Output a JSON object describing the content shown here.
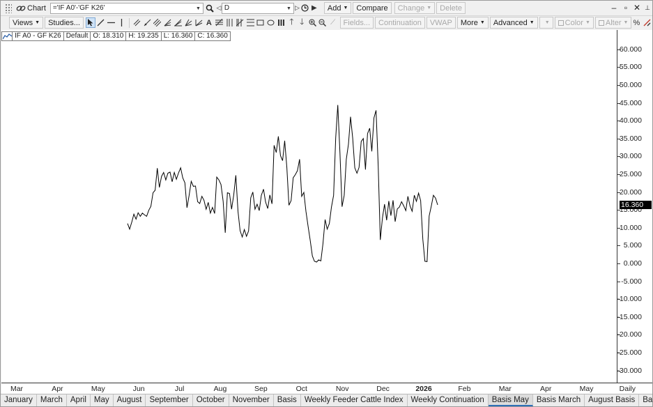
{
  "titlebar": {
    "window_label": "Chart",
    "symbol_value": "='IF A0'-'GF K26'",
    "period_value": "D",
    "buttons": {
      "add": "Add",
      "compare": "Compare",
      "change": "Change",
      "delete": "Delete"
    }
  },
  "toolbar": {
    "views": "Views",
    "studies": "Studies...",
    "fields": "Fields...",
    "continuation": "Continuation",
    "vwap": "VWAP",
    "more": "More",
    "advanced": "Advanced",
    "color": "Color",
    "alter": "Alter",
    "percent": "%"
  },
  "legend": {
    "symbol": "IF A0 - GF K26",
    "template": "Default",
    "open": "O: 18.310",
    "high": "H: 19.235",
    "low": "L: 16.360",
    "close": "C: 16.360"
  },
  "chart_data": {
    "type": "line",
    "series": [
      {
        "values": [
          11.2,
          9.6,
          11.6,
          13.8,
          12.4,
          14.2,
          13.2,
          14.1,
          13.6,
          13.2,
          14.9,
          16.0,
          19.8,
          20.5,
          26.7,
          21.3,
          24.4,
          25.5,
          23.4,
          25.3,
          25.6,
          22.9,
          25.5,
          23.6,
          25.4,
          26.8,
          24.0,
          22.6,
          15.6,
          19.1,
          23.0,
          21.6,
          21.7,
          17.3,
          16.8,
          18.8,
          17.7,
          15.2,
          17.1,
          14.1,
          15.7,
          14.0,
          24.2,
          23.4,
          22.1,
          17.4,
          8.6,
          19.8,
          19.6,
          15.2,
          19.2,
          24.7,
          14.6,
          9.2,
          7.4,
          9.5,
          7.6,
          9.1,
          18.4,
          20.0,
          15.2,
          16.6,
          14.8,
          19.1,
          20.8,
          17.2,
          15.4,
          19.2,
          16.7,
          33.1,
          31.1,
          35.6,
          30.2,
          28.8,
          34.4,
          26.9,
          16.3,
          17.6,
          24.0,
          24.9,
          26.0,
          29.2,
          18.8,
          19.9,
          14.6,
          10.4,
          6.5,
          2.1,
          0.6,
          0.4,
          1.0,
          0.7,
          5.5,
          12.3,
          9.6,
          11.2,
          15.8,
          19.1,
          35.2,
          44.4,
          31.0,
          15.9,
          19.1,
          29.2,
          33.4,
          41.1,
          35.1,
          26.8,
          25.3,
          26.9,
          34.2,
          35.0,
          26.3,
          36.4,
          37.9,
          31.4,
          40.8,
          42.9,
          27.3,
          6.6,
          12.8,
          16.6,
          12.1,
          17.5,
          13.4,
          17.7,
          11.7,
          15.3,
          15.8,
          17.3,
          16.2,
          14.8,
          18.8,
          16.1,
          14.6,
          19.1,
          17.4,
          19.7,
          17.6,
          6.8,
          0.6,
          0.5,
          13.3,
          16.1,
          19.1,
          18.3,
          16.4
        ]
      }
    ],
    "x_labels": [
      "Mar",
      "Apr",
      "May",
      "Jun",
      "Jul",
      "Aug",
      "Sep",
      "Oct",
      "Nov",
      "Dec",
      "2026",
      "Feb",
      "Mar",
      "Apr",
      "May"
    ],
    "y_ticks": [
      60,
      55,
      50,
      45,
      40,
      35,
      30,
      25,
      20,
      15,
      10,
      5,
      0,
      -5,
      -10,
      -15,
      -20,
      -25,
      -30
    ],
    "y_tick_labels": [
      "60.000",
      "55.000",
      "50.000",
      "45.000",
      "40.000",
      "35.000",
      "30.000",
      "25.000",
      "20.000",
      "15.000",
      "10.000",
      "5.000",
      "0.000",
      "-5.000",
      "-10.000",
      "-15.000",
      "-20.000",
      "-25.000",
      "-30.000"
    ],
    "ylim": [
      -33,
      65
    ],
    "last_value": "16.360",
    "periodicity": "Daily",
    "line_color": "#000000"
  },
  "tabs": [
    "January",
    "March",
    "April",
    "May",
    "August",
    "September",
    "October",
    "November",
    "Basis",
    "Weekly Feeder Cattle Index",
    "Weekly Continuation",
    "Basis May",
    "Basis March",
    "August Basis",
    "Basis Se"
  ],
  "active_tab": "Basis May"
}
